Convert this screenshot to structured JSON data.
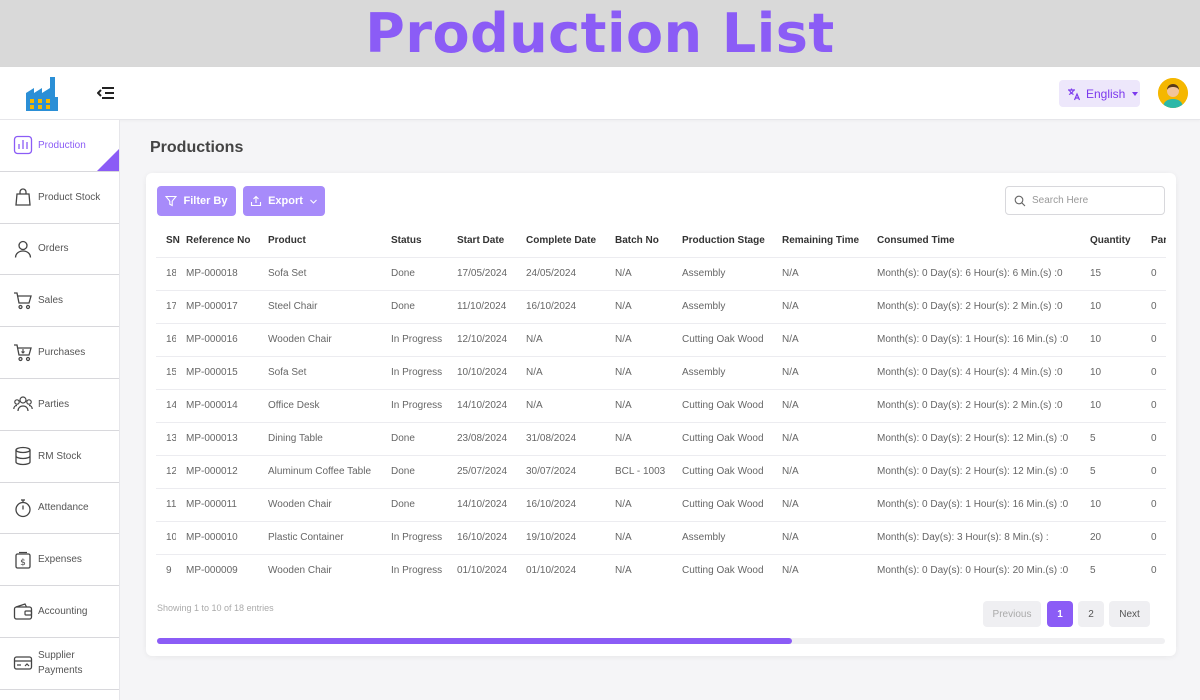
{
  "banner": {
    "title": "Production List"
  },
  "topbar": {
    "language": "English"
  },
  "sidebar": {
    "items": [
      {
        "label": "Production",
        "icon": "bar-chart-icon",
        "active": true
      },
      {
        "label": "Product Stock",
        "icon": "bag-icon"
      },
      {
        "label": "Orders",
        "icon": "user-icon"
      },
      {
        "label": "Sales",
        "icon": "cart-icon"
      },
      {
        "label": "Purchases",
        "icon": "cart-purchase-icon"
      },
      {
        "label": "Parties",
        "icon": "users-group-icon"
      },
      {
        "label": "RM Stock",
        "icon": "database-icon"
      },
      {
        "label": "Attendance",
        "icon": "stopwatch-icon"
      },
      {
        "label": "Expenses",
        "icon": "money-icon"
      },
      {
        "label": "Accounting",
        "icon": "wallet-icon"
      },
      {
        "label": "Supplier Payments",
        "line1": "Supplier",
        "line2": "Payments",
        "icon": "payment-card-icon"
      }
    ]
  },
  "page": {
    "title": "Productions"
  },
  "toolbar": {
    "filter_label": "Filter By",
    "export_label": "Export",
    "search_placeholder": "Search Here"
  },
  "table": {
    "columns": [
      "SN",
      "Reference No",
      "Product",
      "Status",
      "Start Date",
      "Complete Date",
      "Batch No",
      "Production Stage",
      "Remaining Time",
      "Consumed Time",
      "Quantity",
      "Par"
    ],
    "rows": [
      [
        "18",
        "MP-000018",
        "Sofa Set",
        "Done",
        "17/05/2024",
        "24/05/2024",
        "N/A",
        "Assembly",
        "N/A",
        "Month(s): 0 Day(s): 6 Hour(s): 6 Min.(s) :0",
        "15",
        "0"
      ],
      [
        "17",
        "MP-000017",
        "Steel Chair",
        "Done",
        "11/10/2024",
        "16/10/2024",
        "N/A",
        "Assembly",
        "N/A",
        "Month(s): 0 Day(s): 2 Hour(s): 2 Min.(s) :0",
        "10",
        "0"
      ],
      [
        "16",
        "MP-000016",
        "Wooden Chair",
        "In Progress",
        "12/10/2024",
        "N/A",
        "N/A",
        "Cutting Oak Wood",
        "N/A",
        "Month(s): 0 Day(s): 1 Hour(s): 16 Min.(s) :0",
        "10",
        "0"
      ],
      [
        "15",
        "MP-000015",
        "Sofa Set",
        "In Progress",
        "10/10/2024",
        "N/A",
        "N/A",
        "Assembly",
        "N/A",
        "Month(s): 0 Day(s): 4 Hour(s): 4 Min.(s) :0",
        "10",
        "0"
      ],
      [
        "14",
        "MP-000014",
        "Office Desk",
        "In Progress",
        "14/10/2024",
        "N/A",
        "N/A",
        "Cutting Oak Wood",
        "N/A",
        "Month(s): 0 Day(s): 2 Hour(s): 2 Min.(s) :0",
        "10",
        "0"
      ],
      [
        "13",
        "MP-000013",
        "Dining Table",
        "Done",
        "23/08/2024",
        "31/08/2024",
        "N/A",
        "Cutting Oak Wood",
        "N/A",
        "Month(s): 0 Day(s): 2 Hour(s): 12 Min.(s) :0",
        "5",
        "0"
      ],
      [
        "12",
        "MP-000012",
        "Aluminum Coffee Table",
        "Done",
        "25/07/2024",
        "30/07/2024",
        "BCL - 1003",
        "Cutting Oak Wood",
        "N/A",
        "Month(s): 0 Day(s): 2 Hour(s): 12 Min.(s) :0",
        "5",
        "0"
      ],
      [
        "11",
        "MP-000011",
        "Wooden Chair",
        "Done",
        "14/10/2024",
        "16/10/2024",
        "N/A",
        "Cutting Oak Wood",
        "N/A",
        "Month(s): 0 Day(s): 1 Hour(s): 16 Min.(s) :0",
        "10",
        "0"
      ],
      [
        "10",
        "MP-000010",
        "Plastic Container",
        "In Progress",
        "16/10/2024",
        "19/10/2024",
        "N/A",
        "Assembly",
        "N/A",
        "Month(s): Day(s): 3 Hour(s): 8 Min.(s) :",
        "20",
        "0"
      ],
      [
        "9",
        "MP-000009",
        "Wooden Chair",
        "In Progress",
        "01/10/2024",
        "01/10/2024",
        "N/A",
        "Cutting Oak Wood",
        "N/A",
        "Month(s): 0 Day(s): 0 Hour(s): 20 Min.(s) :0",
        "5",
        "0"
      ]
    ]
  },
  "footer": {
    "entries_text": "Showing 1 to 10 of 18 entries",
    "previous_label": "Previous",
    "page1": "1",
    "page2": "2",
    "next_label": "Next",
    "current_page": 1,
    "horizontal_scroll_fraction": 0.63
  },
  "colors": {
    "accent": "#8b5cf6",
    "accent_light": "#a78bfa",
    "banner_bg": "#d9d9d9"
  }
}
